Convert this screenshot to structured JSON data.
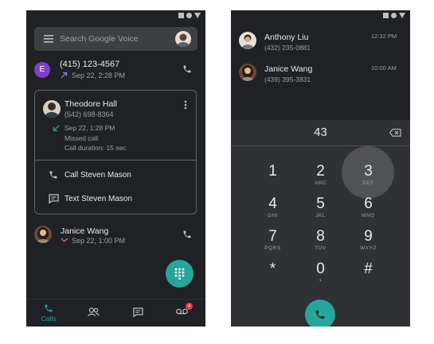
{
  "colors": {
    "phone_bg": "#202124",
    "dialpad_bg": "#303134",
    "accent": "#26a69a",
    "missed": "#e57373",
    "outgoing": "#7986cb",
    "avatar_e": "#7e3fc8"
  },
  "left": {
    "search": {
      "placeholder": "Search Google Voice",
      "icon": "hamburger-menu-icon"
    },
    "calls": [
      {
        "initial": "E",
        "number": "(415) 123-4567",
        "date": "Sep 22, 2:28 PM",
        "icon": "outgoing-arrow-icon"
      },
      {
        "name": "Janice Wang",
        "date": "Sep 22, 1:00 PM",
        "icon": "missed-call-icon"
      }
    ],
    "expanded": {
      "name": "Theodore Hall",
      "number": "(542) 698-8364",
      "date": "Sep 22, 1:28 PM",
      "status": "Missed call",
      "duration": "Call duration: 15 sec",
      "actions": [
        "Call Steven Mason",
        "Text Steven Mason"
      ]
    },
    "nav": {
      "calls_label": "Calls",
      "badge": "4"
    }
  },
  "right": {
    "contacts": [
      {
        "name": "Anthony Liu",
        "number": "(432) 235-0881",
        "time": "12:32 PM"
      },
      {
        "name": "Janice Wang",
        "number": "(439) 395-3831",
        "time": "10:00 AM"
      }
    ],
    "dial_input": "43",
    "keys": [
      {
        "digit": "1",
        "letters": ""
      },
      {
        "digit": "2",
        "letters": "ABC"
      },
      {
        "digit": "3",
        "letters": "DEF"
      },
      {
        "digit": "4",
        "letters": "GHI"
      },
      {
        "digit": "5",
        "letters": "JKL"
      },
      {
        "digit": "6",
        "letters": "MNO"
      },
      {
        "digit": "7",
        "letters": "PQRS"
      },
      {
        "digit": "8",
        "letters": "TUV"
      },
      {
        "digit": "9",
        "letters": "WXYZ"
      },
      {
        "digit": "*",
        "letters": ""
      },
      {
        "digit": "0",
        "letters": "+"
      },
      {
        "digit": "#",
        "letters": ""
      }
    ]
  }
}
